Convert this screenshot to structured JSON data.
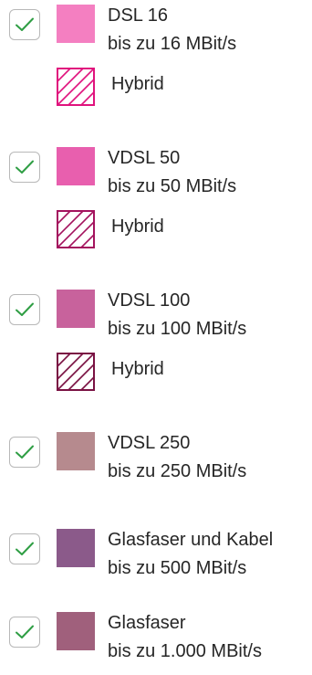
{
  "legend": {
    "items": [
      {
        "title": "DSL 16",
        "speed": "bis zu 16 MBit/s",
        "color": "#f47fc1",
        "checked": true,
        "hybrid": {
          "label": "Hybrid",
          "color": "#e0137d"
        }
      },
      {
        "title": "VDSL 50",
        "speed": "bis zu 50 MBit/s",
        "color": "#e85fae",
        "checked": true,
        "hybrid": {
          "label": "Hybrid",
          "color": "#a4135e"
        }
      },
      {
        "title": "VDSL 100",
        "speed": "bis zu 100 MBit/s",
        "color": "#c8629c",
        "checked": true,
        "hybrid": {
          "label": "Hybrid",
          "color": "#7a1243"
        }
      },
      {
        "title": "VDSL 250",
        "speed": "bis zu 250 MBit/s",
        "color": "#b68a8e",
        "checked": true
      },
      {
        "title": "Glasfaser und Kabel",
        "speed": "bis zu 500 MBit/s",
        "color": "#8b5a8a",
        "checked": true
      },
      {
        "title": "Glasfaser",
        "speed": "bis zu 1.000 MBit/s",
        "color": "#a0607c",
        "checked": true
      }
    ],
    "checkmark_color": "#2f9e44",
    "checkbox_icon": "check-icon",
    "hybrid_icon": "hatched-swatch-icon"
  }
}
